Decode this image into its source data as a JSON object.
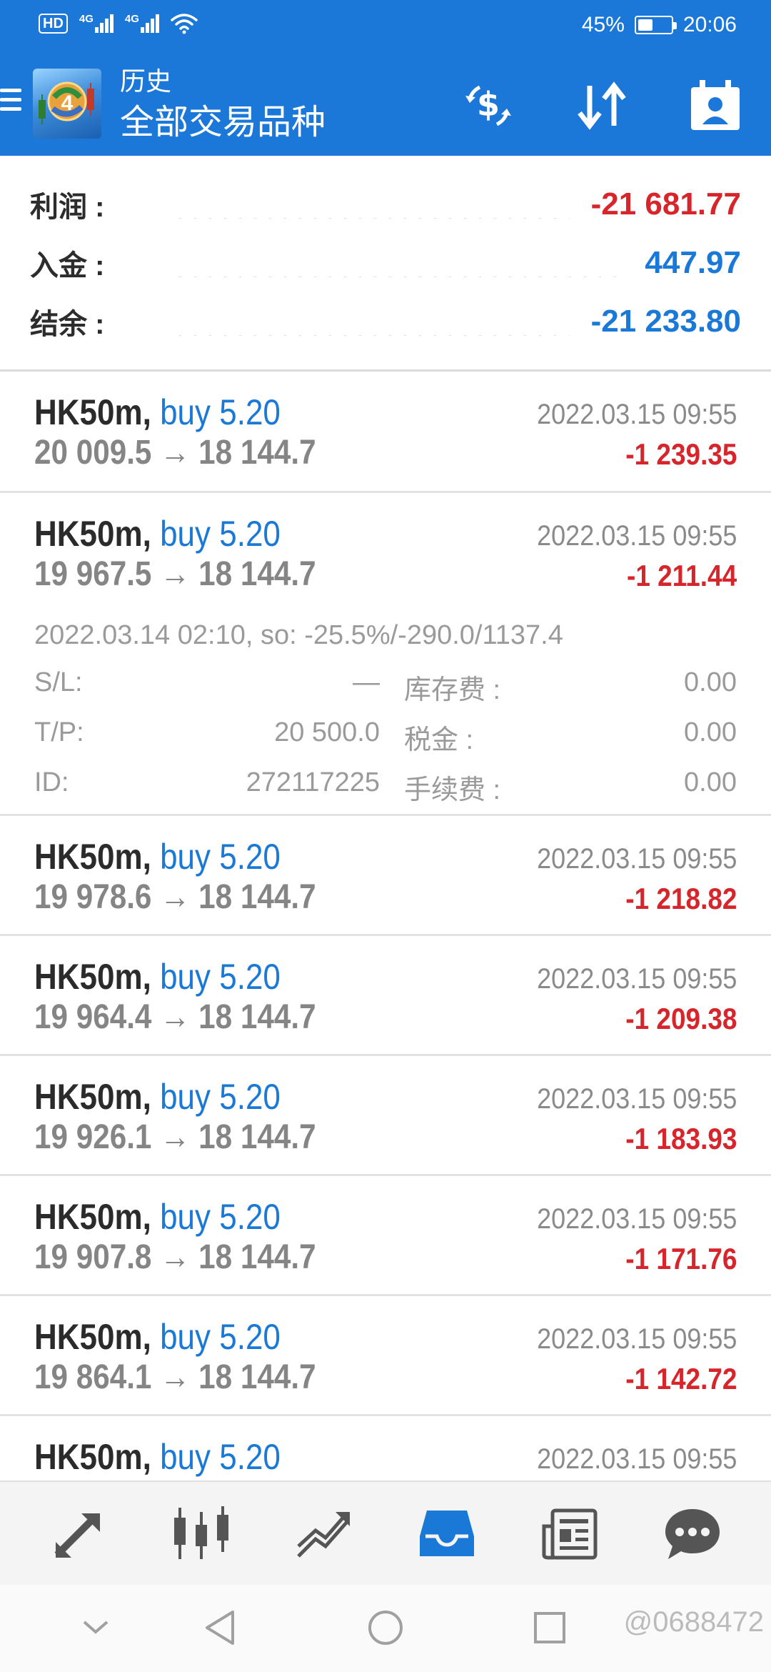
{
  "status_bar": {
    "hd": "HD",
    "network1": "4G",
    "network2": "4G",
    "battery_pct": "45%",
    "battery_level": 0.45,
    "time": "20:06"
  },
  "app_bar": {
    "title": "历史",
    "subtitle": "全部交易品种",
    "icons": [
      "menu-icon",
      "app-logo",
      "currency-exchange-icon",
      "sort-icon",
      "calendar-person-icon"
    ]
  },
  "summary": {
    "profit_label": "利润 :",
    "profit_value": "-21 681.77",
    "deposit_label": "入金 :",
    "deposit_value": "447.97",
    "balance_label": "结余 :",
    "balance_value": "-21 233.80"
  },
  "deals": [
    {
      "symbol": "HK50m,",
      "type": "buy 5.20",
      "time": "2022.03.15 09:55",
      "prices": "20 009.5 → 18 144.7",
      "profit": "-1 239.35"
    },
    {
      "symbol": "HK50m,",
      "type": "buy 5.20",
      "time": "2022.03.15 09:55",
      "prices": "19 967.5 → 18 144.7",
      "profit": "-1 211.44",
      "detail": {
        "open_info": "2022.03.14 02:10, so: -25.5%/-290.0/1137.4",
        "sl_label": "S/L:",
        "sl_value": "—",
        "tp_label": "T/P:",
        "tp_value": "20 500.0",
        "id_label": "ID:",
        "id_value": "272117225",
        "swap_label": "库存费 :",
        "swap_value": "0.00",
        "tax_label": "税金 :",
        "tax_value": "0.00",
        "fee_label": "手续费 :",
        "fee_value": "0.00"
      }
    },
    {
      "symbol": "HK50m,",
      "type": "buy 5.20",
      "time": "2022.03.15 09:55",
      "prices": "19 978.6 → 18 144.7",
      "profit": "-1 218.82"
    },
    {
      "symbol": "HK50m,",
      "type": "buy 5.20",
      "time": "2022.03.15 09:55",
      "prices": "19 964.4 → 18 144.7",
      "profit": "-1 209.38"
    },
    {
      "symbol": "HK50m,",
      "type": "buy 5.20",
      "time": "2022.03.15 09:55",
      "prices": "19 926.1 → 18 144.7",
      "profit": "-1 183.93"
    },
    {
      "symbol": "HK50m,",
      "type": "buy 5.20",
      "time": "2022.03.15 09:55",
      "prices": "19 907.8 → 18 144.7",
      "profit": "-1 171.76"
    },
    {
      "symbol": "HK50m,",
      "type": "buy 5.20",
      "time": "2022.03.15 09:55",
      "prices": "19 864.1 → 18 144.7",
      "profit": "-1 142.72"
    },
    {
      "symbol": "HK50m,",
      "type": "buy 5.20",
      "time": "2022.03.15 09:55",
      "prices": "",
      "profit": ""
    }
  ],
  "bottom_nav": {
    "items": [
      "quotes-icon",
      "chart-icon",
      "trade-icon",
      "history-icon",
      "news-icon",
      "chat-icon"
    ],
    "active": "history-icon",
    "active_color": "#1a79d6"
  },
  "system_nav": {
    "items": [
      "collapse-icon",
      "back-icon",
      "home-icon",
      "recents-icon"
    ],
    "watermark": "@0688472"
  },
  "colors": {
    "header_blue": "#1b78d8",
    "profit_red": "#d7262b",
    "value_blue": "#1a79d6"
  }
}
